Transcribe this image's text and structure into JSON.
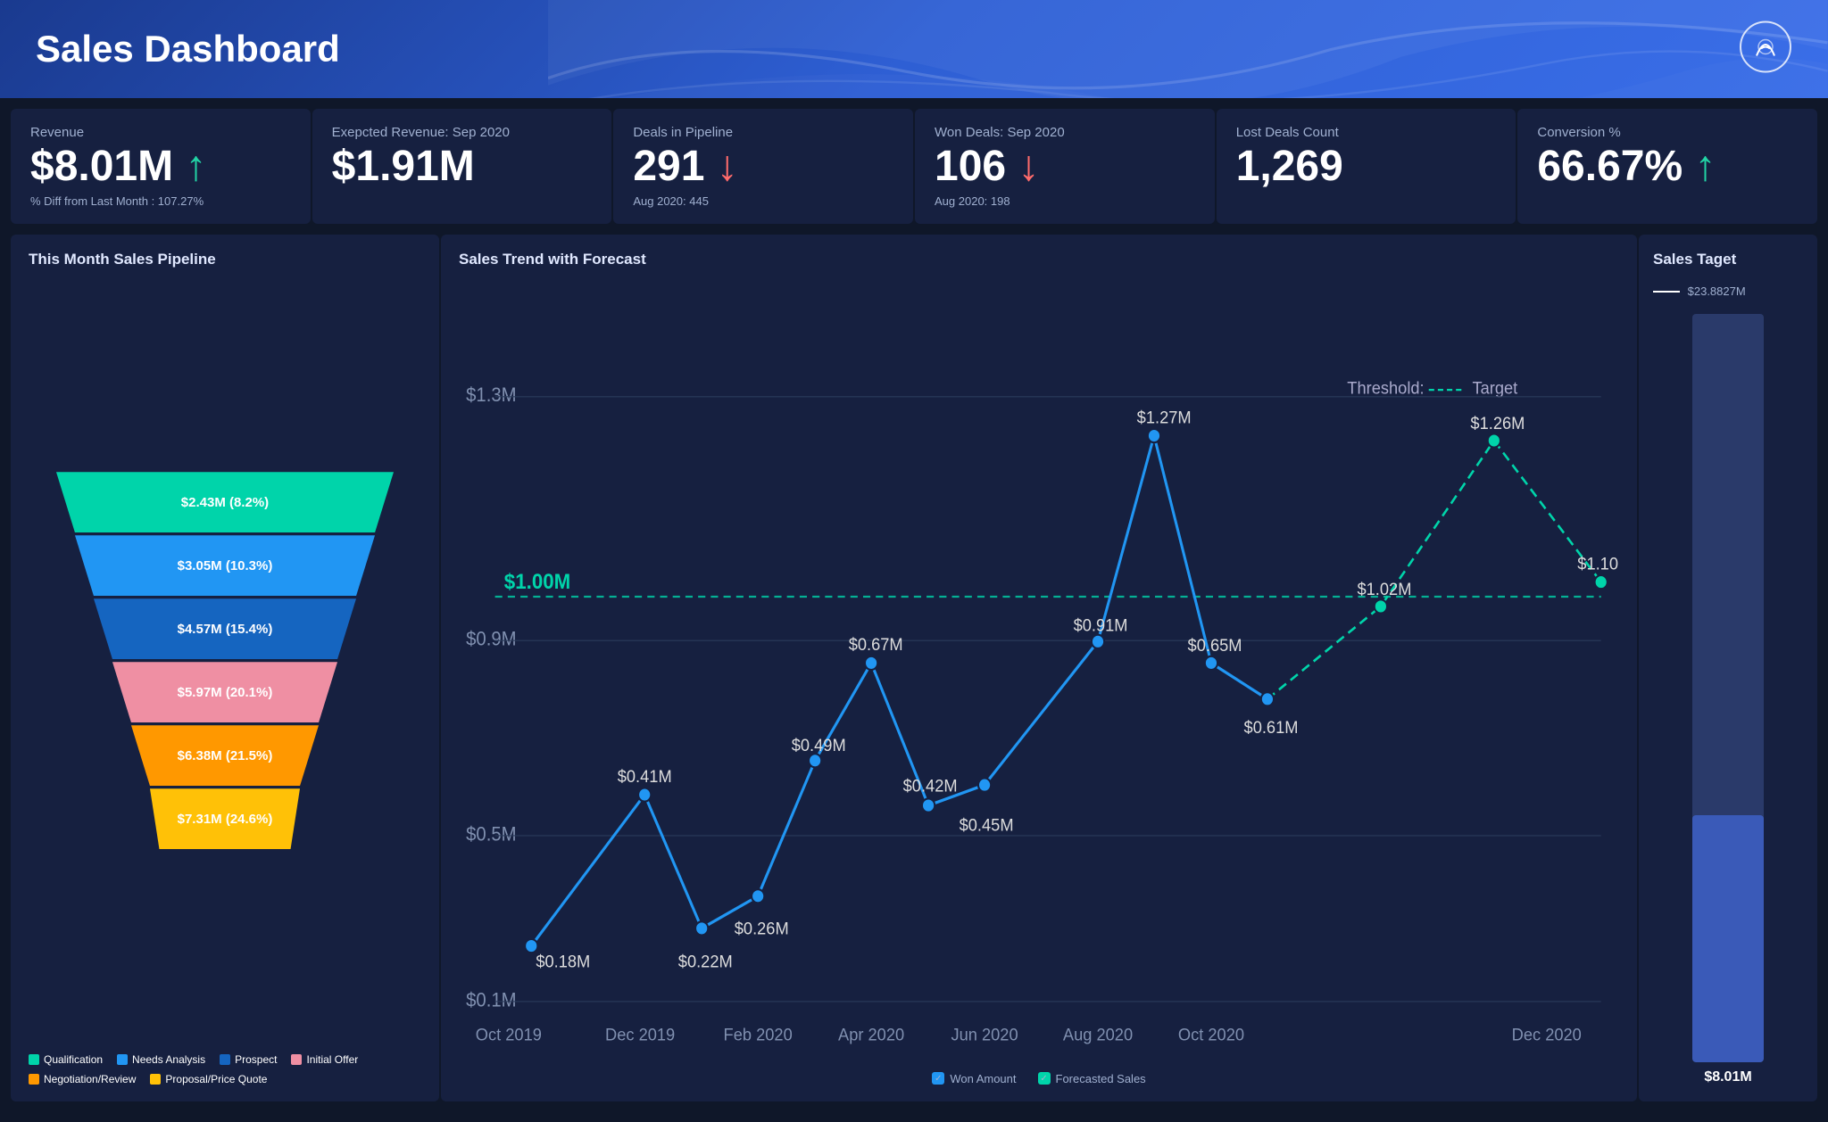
{
  "header": {
    "title": "Sales Dashboard",
    "logo_alt": "adobe-logo"
  },
  "kpis": [
    {
      "label": "Revenue",
      "value": "$8.01M",
      "arrow": "↑",
      "arrow_type": "up",
      "sub": "% Diff from Last Month : 107.27%"
    },
    {
      "label": "Exepcted Revenue: Sep 2020",
      "value": "$1.91M",
      "arrow": "",
      "arrow_type": "",
      "sub": ""
    },
    {
      "label": "Deals in Pipeline",
      "value": "291",
      "arrow": "↓",
      "arrow_type": "down",
      "sub": "Aug 2020: 445"
    },
    {
      "label": "Won Deals: Sep 2020",
      "value": "106",
      "arrow": "↓",
      "arrow_type": "down",
      "sub": "Aug 2020: 198"
    },
    {
      "label": "Lost Deals Count",
      "value": "1,269",
      "arrow": "",
      "arrow_type": "",
      "sub": ""
    },
    {
      "label": "Conversion %",
      "value": "66.67%",
      "arrow": "↑",
      "arrow_type": "up",
      "sub": ""
    }
  ],
  "funnel": {
    "title": "This Month Sales Pipeline",
    "segments": [
      {
        "label": "$2.43M (8.2%)",
        "color": "#00d4aa",
        "width_pct": 90
      },
      {
        "label": "$3.05M (10.3%)",
        "color": "#2196f3",
        "width_pct": 80
      },
      {
        "label": "$4.57M (15.4%)",
        "color": "#1565c0",
        "width_pct": 70
      },
      {
        "label": "$5.97M (20.1%)",
        "color": "#ef8fa3",
        "width_pct": 60
      },
      {
        "label": "$6.38M (21.5%)",
        "color": "#ff9800",
        "width_pct": 50
      },
      {
        "label": "$7.31M (24.6%)",
        "color": "#ffc107",
        "width_pct": 40
      }
    ],
    "legend": [
      {
        "label": "Qualification",
        "color": "#00d4aa"
      },
      {
        "label": "Needs Analysis",
        "color": "#2196f3"
      },
      {
        "label": "Prospect",
        "color": "#1565c0"
      },
      {
        "label": "Initial Offer",
        "color": "#ef8fa3"
      },
      {
        "label": "Negotiation/Review",
        "color": "#ff9800"
      },
      {
        "label": "Proposal/Price Quote",
        "color": "#ffc107"
      }
    ]
  },
  "chart": {
    "title": "Sales Trend with Forecast",
    "threshold_label": "Threshold:",
    "target_label": "Target",
    "y_labels": [
      "$1.3M",
      "$0.9M",
      "$0.5M",
      "$0.1M"
    ],
    "x_labels": [
      "Oct 2019",
      "Dec 2019",
      "Feb 2020",
      "Apr 2020",
      "Jun 2020",
      "Aug 2020",
      "Oct 2020",
      "Dec 2020"
    ],
    "won_points": [
      {
        "x": "Oct 2019",
        "val": "$0.18M"
      },
      {
        "x": "Dec 2019",
        "val": "$0.41M"
      },
      {
        "x": "Jan 2020",
        "val": "$0.22M"
      },
      {
        "x": "Feb 2020",
        "val": "$0.26M"
      },
      {
        "x": "Mar 2020",
        "val": "$0.49M"
      },
      {
        "x": "Apr 2020",
        "val": "$0.67M"
      },
      {
        "x": "May 2020",
        "val": "$0.42M"
      },
      {
        "x": "Jun 2020",
        "val": "$0.45M"
      },
      {
        "x": "Aug 2020",
        "val": "$0.91M"
      },
      {
        "x": "Sep 2020",
        "val": "$1.27M"
      },
      {
        "x": "Oct 2020",
        "val": "$0.65M"
      },
      {
        "x": "Nov 2020",
        "val": "$0.61M"
      }
    ],
    "forecast_points": [
      {
        "x": "Nov 2020",
        "val": "$0.61M"
      },
      {
        "x": "Dec 2020",
        "val": "$1.02M"
      },
      {
        "x": "Jan 2021",
        "val": "$1.26M"
      },
      {
        "x": "Feb 2021",
        "val": "$1.10M"
      }
    ],
    "threshold_value": "$1.00M",
    "legend": [
      {
        "label": "Won Amount",
        "color": "#2196f3"
      },
      {
        "label": "Forecasted Sales",
        "color": "#00d4aa"
      }
    ]
  },
  "target": {
    "title": "Sales Taget",
    "threshold_value": "$23.8827M",
    "current_value": "$8.01M",
    "fill_pct": 33
  }
}
